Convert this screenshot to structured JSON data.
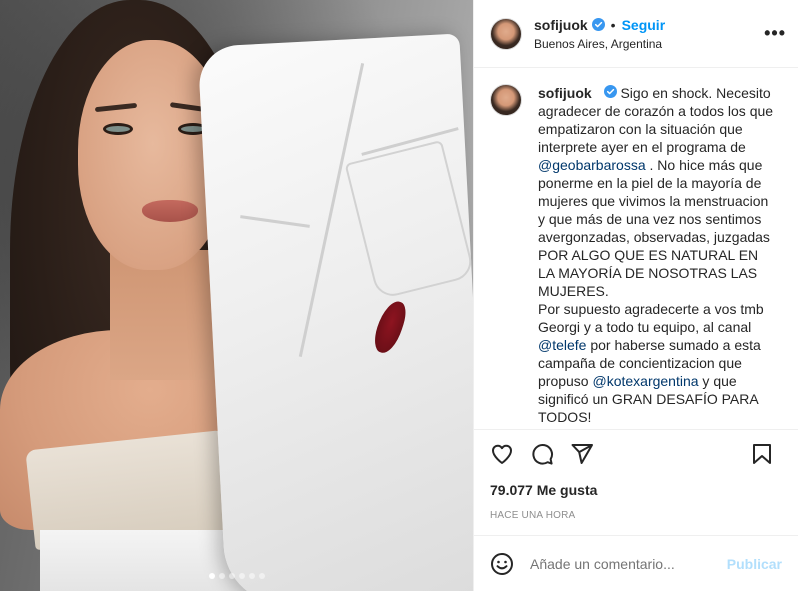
{
  "post": {
    "author": {
      "username": "sofijuok",
      "verified": true,
      "location": "Buenos Aires, Argentina"
    },
    "header": {
      "separator": "•",
      "follow_label": "Seguir",
      "more_icon": "more-horizontal-icon",
      "more_glyph": "•••"
    },
    "caption": {
      "username": "sofijuok",
      "segments": [
        {
          "type": "text",
          "value": "Sigo en shock. Necesito agradecer de corazón a todos los que empatizaron con la situación que interprete ayer en el programa de "
        },
        {
          "type": "mention",
          "value": "@geobarbarossa"
        },
        {
          "type": "text",
          "value": " . No hice más que ponerme en la piel de la mayoría de mujeres que vivimos la menstruacion y que más de una vez nos sentimos avergonzadas, observadas, juzgadas POR ALGO QUE ES NATURAL EN LA MAYORÍA DE NOSOTRAS LAS MUJERES."
        },
        {
          "type": "break"
        },
        {
          "type": "text",
          "value": "Por supuesto agradecerte a vos tmb Georgi y a todo tu equipo, al canal "
        },
        {
          "type": "mention",
          "value": "@telefe"
        },
        {
          "type": "text",
          "value": " por haberse sumado a esta campaña de concientizacion que propuso "
        },
        {
          "type": "mention",
          "value": "@kotexargentina"
        },
        {
          "type": "text",
          "value": " y que significó un GRAN DESAFÍO PARA TODOS!"
        }
      ]
    },
    "actions": {
      "icons": [
        "heart-icon",
        "comment-icon",
        "share-icon",
        "bookmark-icon"
      ]
    },
    "likes_text": "79.077 Me gusta",
    "timestamp": "HACE UNA HORA",
    "comment_box": {
      "emoji_icon": "smiley-icon",
      "placeholder": "Añade un comentario...",
      "publish_label": "Publicar"
    },
    "carousel": {
      "dots": 6,
      "active_index": 0
    },
    "colors": {
      "link_blue": "#0095f6",
      "mention": "#00376b",
      "publish_disabled": "#b2dffc",
      "muted": "#8e8e8e",
      "text": "#262626",
      "verified": "#3897f0",
      "stain": "#8e1420"
    }
  }
}
